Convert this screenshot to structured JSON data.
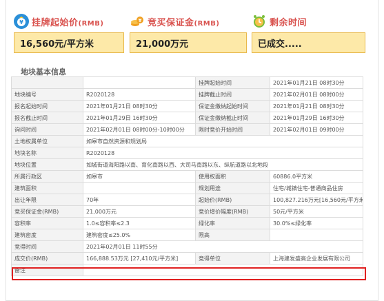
{
  "summary": {
    "start_price": {
      "label": "挂牌起始价",
      "unit": "(RMB)",
      "value": "16,560元/平方米",
      "icon": "money-bag-icon"
    },
    "deposit": {
      "label": "竞买保证金",
      "unit": "(RMB)",
      "value": "21,000万元",
      "icon": "coins-icon"
    },
    "time_left": {
      "label": "剩余时间",
      "unit": "",
      "value": "已成交.....",
      "icon": "alarm-clock-icon"
    }
  },
  "section_title": "地块基本信息",
  "rows": [
    [
      "",
      "",
      "挂牌起始时间",
      "2021年01月21日 08时30分"
    ],
    [
      "地块编号",
      "R2020128",
      "挂牌截止时间",
      "2021年02月01日 08时00分"
    ],
    [
      "报名起始时间",
      "2021年01月21日 08时30分",
      "保证金缴纳起始时间",
      "2021年01月21日 08时30分"
    ],
    [
      "报名截止时间",
      "2021年01月29日 16时30分",
      "保证金缴纳截止时间",
      "2021年01月29日 16时30分"
    ],
    [
      "询问时间",
      "2021年02月01日 08时00分-10时00分",
      "限时竞价开始时间",
      "2021年02月01日 09时00分"
    ],
    [
      "土地权属单位",
      "如皋市自然资源和规划局",
      "",
      ""
    ],
    [
      "地块名称",
      "R2020128",
      "",
      ""
    ],
    [
      "地块位置",
      "如城街道海阳路以南、育化南路以西、大司马南路以东、纵航道路以北地段",
      "",
      ""
    ],
    [
      "所属行政区",
      "如皋市",
      "使用权面积",
      "60886.0平方米"
    ],
    [
      "建筑面积",
      "",
      "规划用途",
      "住宅/城镇住宅-普通商品住房"
    ],
    [
      "出让年限",
      "70年",
      "起始价(RMB)",
      "100,827.216万元[16,560元/平方米]"
    ],
    [
      "竞买保证金(RMB)",
      "21,000万元",
      "竞价增价幅度(RMB)",
      "50元/平方米"
    ],
    [
      "容积率",
      "1.0≤容积率≤2.3",
      "绿化率",
      "30.0%≤绿化率"
    ],
    [
      "建筑密度",
      "建筑密度≤25.0%",
      "限高",
      ""
    ],
    [
      "竞得时间",
      "2021年02月01日 11时55分",
      "",
      ""
    ],
    [
      "成交价(RMB)",
      "166,888.53万元 [27,410元/平方米]",
      "竞得单位",
      "上海建发盛高企业发展有限公司"
    ],
    [
      "备注",
      "",
      "",
      ""
    ]
  ]
}
